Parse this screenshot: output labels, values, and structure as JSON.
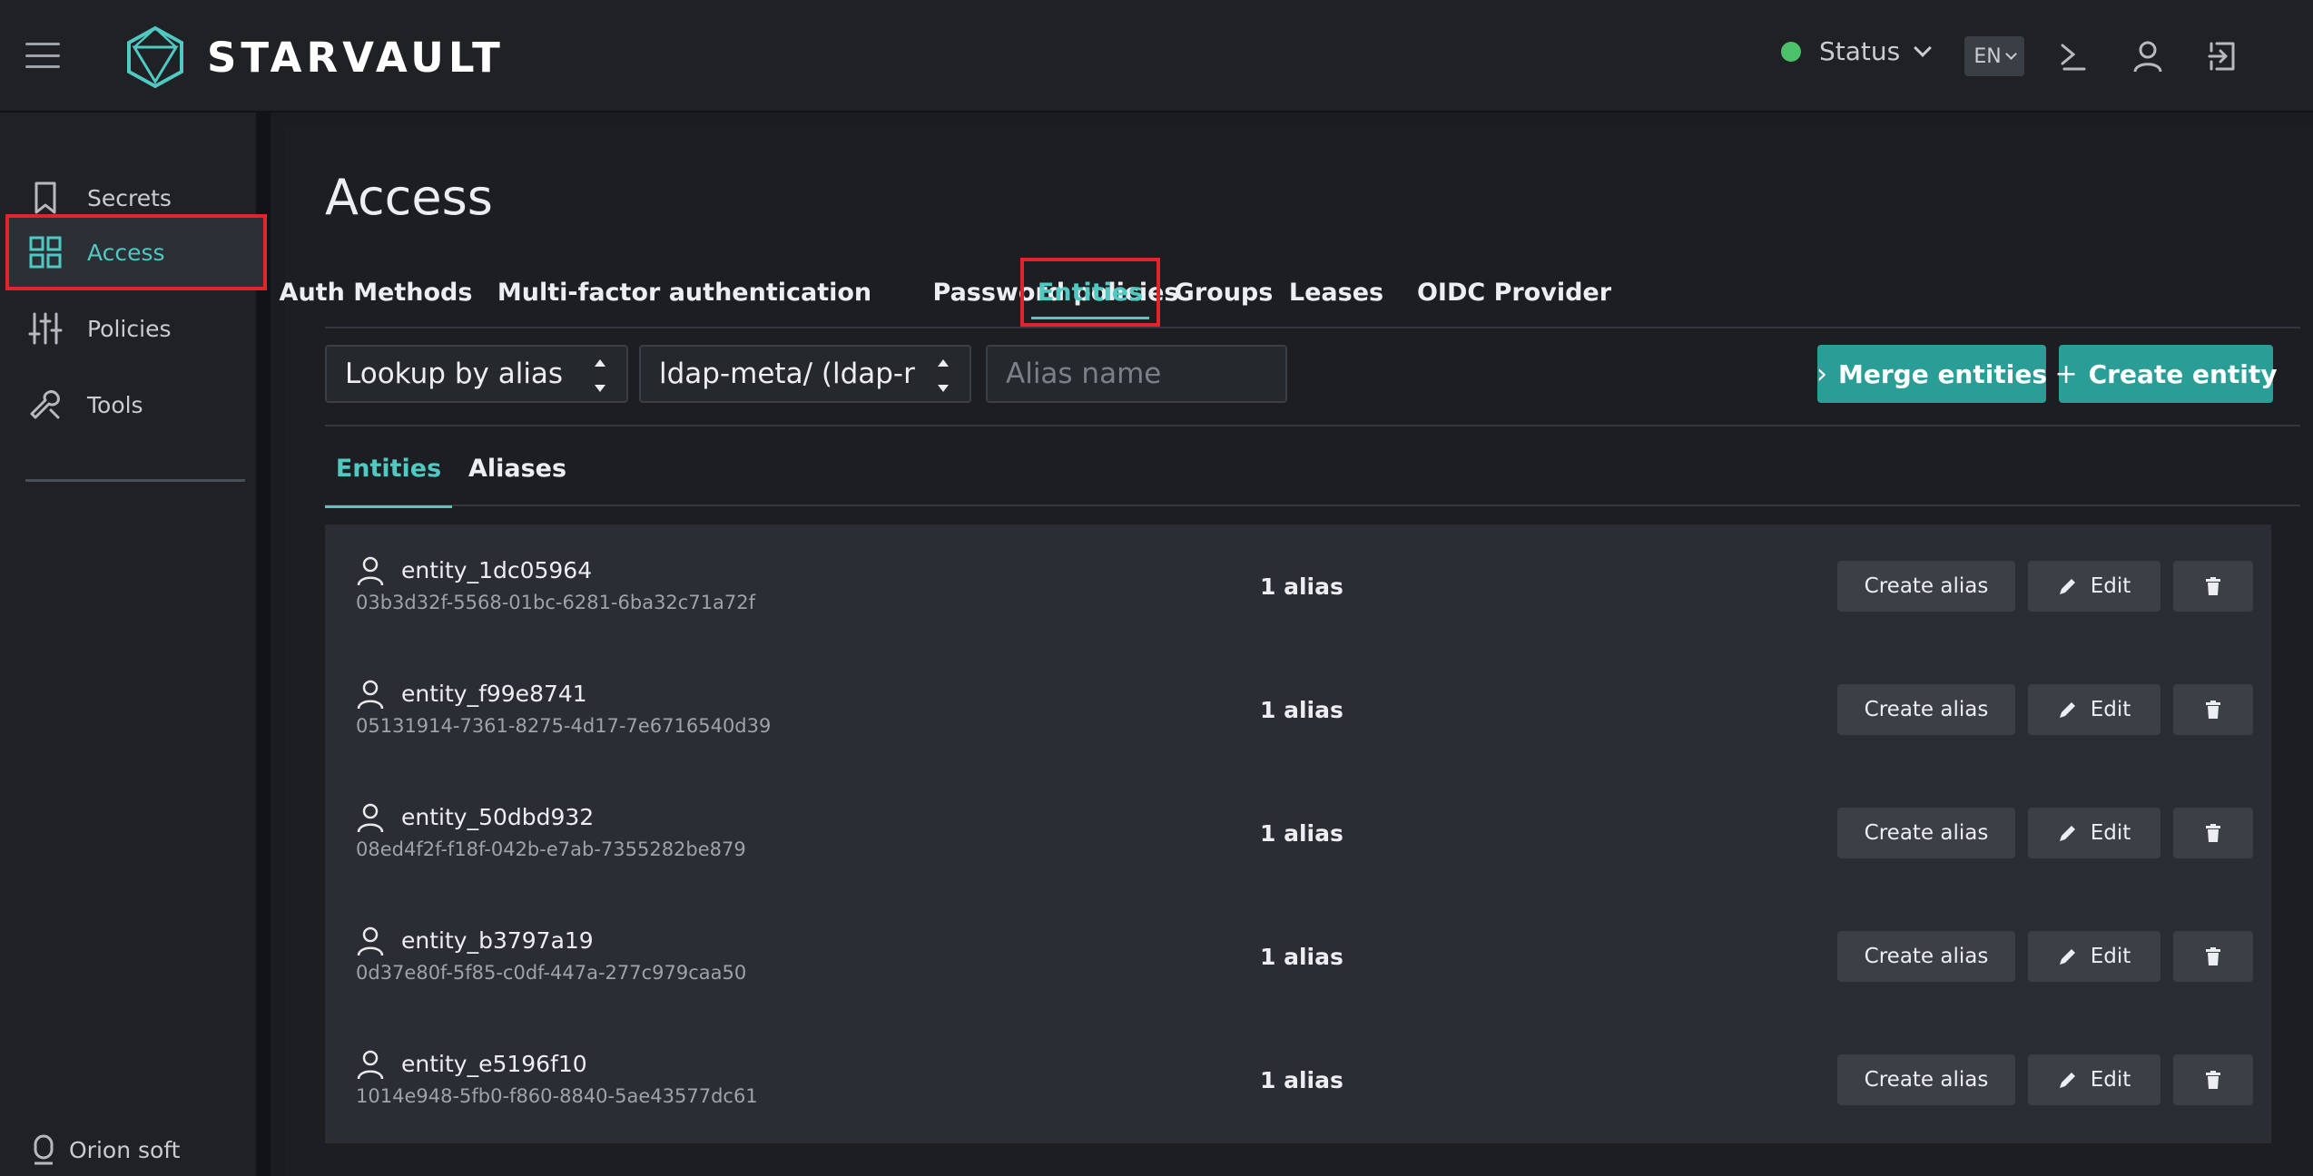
{
  "header": {
    "brand": "STARVAULT",
    "status_label": "Status",
    "status_color": "#4cc36a",
    "lang": "EN",
    "icons": [
      "menu-icon",
      "console-icon",
      "user-icon",
      "logout-icon"
    ]
  },
  "sidebar": {
    "items": [
      {
        "label": "Secrets",
        "icon": "bookmark-icon"
      },
      {
        "label": "Access",
        "icon": "grid-icon"
      },
      {
        "label": "Policies",
        "icon": "sliders-icon"
      },
      {
        "label": "Tools",
        "icon": "wrench-icon"
      }
    ],
    "footer_brand": "Orion soft"
  },
  "page": {
    "title": "Access",
    "tabs": [
      "Auth Methods",
      "Multi-factor authentication",
      "Password policies",
      "Entities",
      "Groups",
      "Leases",
      "OIDC Provider"
    ],
    "active_tab": "Entities"
  },
  "toolbar": {
    "lookup_select": "Lookup by alias",
    "mount_select": "ldap-meta/ (ldap-r",
    "alias_placeholder": "Alias name",
    "merge_label": "Merge entities",
    "create_label": "Create entity"
  },
  "subtabs": [
    "Entities",
    "Aliases"
  ],
  "entities": [
    {
      "name": "entity_1dc05964",
      "id": "03b3d32f-5568-01bc-6281-6ba32c71a72f",
      "aliases": "1 alias"
    },
    {
      "name": "entity_f99e8741",
      "id": "05131914-7361-8275-4d17-7e6716540d39",
      "aliases": "1 alias"
    },
    {
      "name": "entity_50dbd932",
      "id": "08ed4f2f-f18f-042b-e7ab-7355282be879",
      "aliases": "1 alias"
    },
    {
      "name": "entity_b3797a19",
      "id": "0d37e80f-5f85-c0df-447a-277c979caa50",
      "aliases": "1 alias"
    },
    {
      "name": "entity_e5196f10",
      "id": "1014e948-5fb0-f860-8840-5ae43577dc61",
      "aliases": "1 alias"
    }
  ],
  "row_actions": {
    "create_alias": "Create alias",
    "edit": "Edit"
  },
  "colors": {
    "accent": "#4fc9c2",
    "button_teal": "#2a9d96",
    "highlight": "#e0262b"
  }
}
